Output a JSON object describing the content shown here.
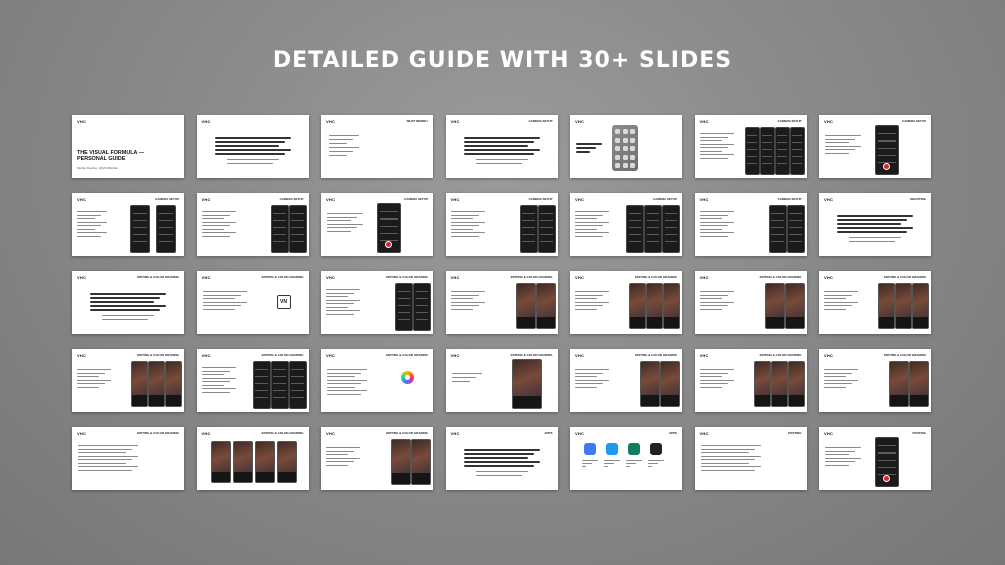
{
  "page": {
    "headline": "DETAILED GUIDE WITH 30+ SLIDES"
  },
  "cover": {
    "logo": "VHC",
    "title": "THE VISUAL FORMULA — PERSONAL GUIDE",
    "subtitle": "Mobile Routine / @VHCMobile"
  },
  "slide_headers": {
    "logo": "VHC",
    "camera_setup": "CAMERA SETUP",
    "editing": "EDITING & COLOR GRADING",
    "shooting": "SHOOTING",
    "apps": "APPS",
    "posting": "POSTING",
    "what_inside": "WHAT INSIDE?"
  },
  "slides": [
    {
      "type": "cover"
    },
    {
      "type": "text-center",
      "header": ""
    },
    {
      "type": "list",
      "header": "what_inside"
    },
    {
      "type": "text-center",
      "header": "camera_setup"
    },
    {
      "type": "camera-control",
      "header": ""
    },
    {
      "type": "phones-right",
      "header": "camera_setup",
      "phones": 4
    },
    {
      "type": "phone-single",
      "header": "camera_setup"
    },
    {
      "type": "phones-mid",
      "header": "camera_setup"
    },
    {
      "type": "phones-right",
      "header": "camera_setup",
      "phones": 2
    },
    {
      "type": "phone-single",
      "header": "camera_setup"
    },
    {
      "type": "phones-right",
      "header": "camera_setup",
      "phones": 2
    },
    {
      "type": "phones-right",
      "header": "camera_setup",
      "phones": 3
    },
    {
      "type": "phones-right",
      "header": "camera_setup",
      "phones": 2
    },
    {
      "type": "text-center",
      "header": "shooting"
    },
    {
      "type": "text-center",
      "header": "editing"
    },
    {
      "type": "vn",
      "header": "editing",
      "vn_label": "VN"
    },
    {
      "type": "phones-right",
      "header": "editing",
      "phones": 2
    },
    {
      "type": "photos",
      "header": "editing",
      "count": 2
    },
    {
      "type": "photos",
      "header": "editing",
      "count": 3
    },
    {
      "type": "photos",
      "header": "editing",
      "count": 2
    },
    {
      "type": "photos",
      "header": "editing",
      "count": 3
    },
    {
      "type": "photos",
      "header": "editing",
      "count": 3
    },
    {
      "type": "phones-right",
      "header": "editing",
      "phones": 3
    },
    {
      "type": "flower",
      "header": "editing"
    },
    {
      "type": "photo-single",
      "header": "editing"
    },
    {
      "type": "photos",
      "header": "editing",
      "count": 2
    },
    {
      "type": "photos",
      "header": "editing",
      "count": 3
    },
    {
      "type": "photos",
      "header": "editing",
      "count": 2
    },
    {
      "type": "text-left",
      "header": "editing"
    },
    {
      "type": "photos-wide",
      "header": "editing",
      "count": 4
    },
    {
      "type": "photos",
      "header": "editing",
      "count": 2
    },
    {
      "type": "text-center",
      "header": "apps"
    },
    {
      "type": "apps",
      "header": "apps"
    },
    {
      "type": "text-left",
      "header": "posting"
    },
    {
      "type": "phone-single",
      "header": "posting"
    }
  ],
  "app_icon_colors": [
    "#3b7bf6",
    "#1d9bf0",
    "#0f7b5f",
    "#222222"
  ],
  "colors": {
    "background": "#8a8a8a",
    "headline": "#ffffff",
    "slide": "#ffffff",
    "accent_red": "#d22222"
  }
}
